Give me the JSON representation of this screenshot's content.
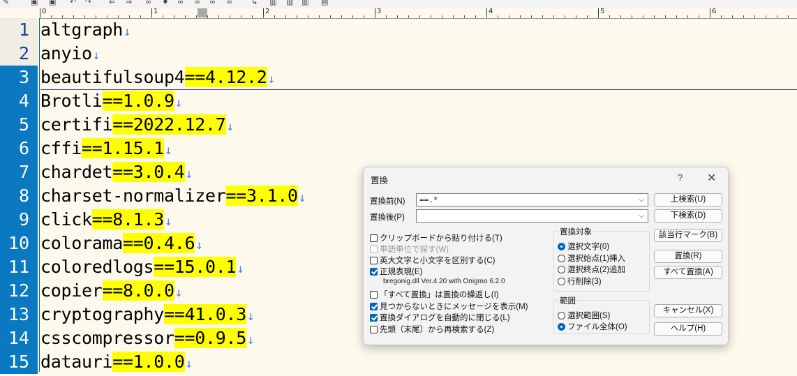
{
  "editor": {
    "ruler_marks": [
      "0",
      "1",
      "2",
      "3",
      "4",
      "5",
      "6"
    ],
    "lines": [
      {
        "num": "1",
        "name": "altgraph",
        "version": "",
        "selected": false
      },
      {
        "num": "2",
        "name": "anyio",
        "version": "",
        "selected": false
      },
      {
        "num": "3",
        "name": "beautifulsoup4",
        "version": "==4.12.2",
        "selected": true
      },
      {
        "num": "4",
        "name": "Brotli",
        "version": "==1.0.9",
        "selected": true
      },
      {
        "num": "5",
        "name": "certifi",
        "version": "==2022.12.7",
        "selected": true
      },
      {
        "num": "6",
        "name": "cffi",
        "version": "==1.15.1",
        "selected": true
      },
      {
        "num": "7",
        "name": "chardet",
        "version": "==3.0.4",
        "selected": true
      },
      {
        "num": "8",
        "name": "charset-normalizer",
        "version": "==3.1.0",
        "selected": true
      },
      {
        "num": "9",
        "name": "click",
        "version": "==8.1.3",
        "selected": true
      },
      {
        "num": "10",
        "name": "colorama",
        "version": "==0.4.6",
        "selected": true
      },
      {
        "num": "11",
        "name": "coloredlogs",
        "version": "==15.0.1",
        "selected": true
      },
      {
        "num": "12",
        "name": "copier",
        "version": "==8.0.0",
        "selected": true
      },
      {
        "num": "13",
        "name": "cryptography",
        "version": "==41.0.3",
        "selected": true
      },
      {
        "num": "14",
        "name": "csscompressor",
        "version": "==0.9.5",
        "selected": true
      },
      {
        "num": "15",
        "name": "datauri",
        "version": "==1.0.0",
        "selected": true
      }
    ],
    "eol_mark": "↓",
    "colors": {
      "highlight": "#ffff00",
      "selected_gutter": "#0b78c2",
      "number": "#1b3f9e"
    }
  },
  "dialog": {
    "title": "置換",
    "help_symbol": "?",
    "close_symbol": "✕",
    "find_label": "置換前(N)",
    "find_value": "==.*",
    "replace_label": "置換後(P)",
    "replace_value": "",
    "buttons": {
      "search_up": "上検索(U)",
      "search_down": "下検索(D)",
      "mark_lines": "該当行マーク(B)",
      "replace": "置換(R)",
      "replace_all": "すべて置換(A)",
      "cancel": "キャンセル(X)",
      "help": "ヘルプ(H)"
    },
    "options": [
      {
        "label": "クリップボードから貼り付ける(T)",
        "checked": false,
        "disabled": false
      },
      {
        "label": "単語単位で探す(W)",
        "checked": false,
        "disabled": true
      },
      {
        "label": "英大文字と小文字を区別する(C)",
        "checked": false,
        "disabled": false
      },
      {
        "label": "正規表現(E)",
        "checked": true,
        "disabled": false
      },
      {
        "label": "「すべて置換」は置換の繰返し(I)",
        "checked": false,
        "disabled": false
      },
      {
        "label": "見つからないときにメッセージを表示(M)",
        "checked": true,
        "disabled": false
      },
      {
        "label": "置換ダイアログを自動的に閉じる(L)",
        "checked": true,
        "disabled": false
      },
      {
        "label": "先頭（末尾）から再検索する(Z)",
        "checked": false,
        "disabled": false
      }
    ],
    "regex_lib_note": "bregonig.dll Ver.4.20 with Onigmo 6.2.0",
    "target_group": {
      "title": "置換対象",
      "options": [
        {
          "label": "選択文字(0)",
          "selected": true
        },
        {
          "label": "選択始点(1)挿入",
          "selected": false
        },
        {
          "label": "選択終点(2)追加",
          "selected": false
        },
        {
          "label": "行削除(3)",
          "selected": false
        }
      ]
    },
    "range_group": {
      "title": "範囲",
      "options": [
        {
          "label": "選択範囲(S)",
          "selected": false
        },
        {
          "label": "ファイル全体(O)",
          "selected": true
        }
      ]
    }
  }
}
